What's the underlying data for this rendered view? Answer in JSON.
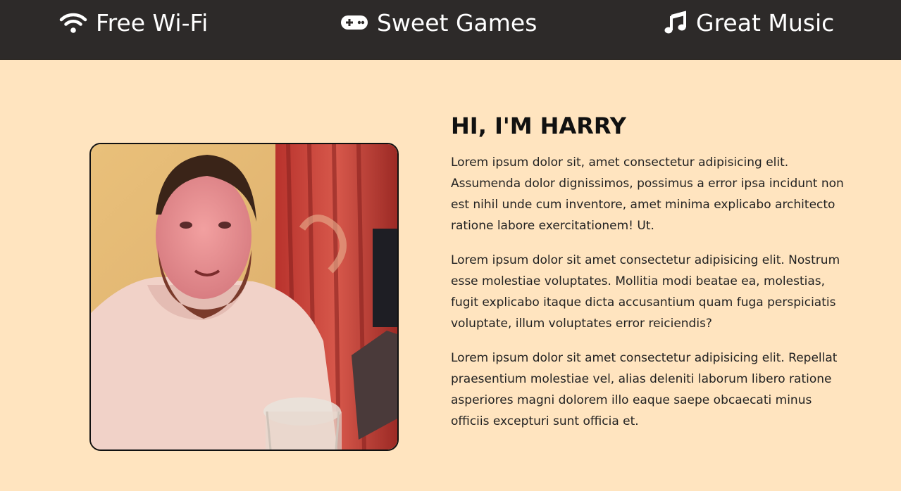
{
  "header": {
    "features": [
      {
        "icon": "wifi-icon",
        "label": "Free Wi-Fi"
      },
      {
        "icon": "gamepad-icon",
        "label": "Sweet Games"
      },
      {
        "icon": "music-note-icon",
        "label": "Great Music"
      }
    ]
  },
  "about": {
    "heading": "HI, I'M HARRY",
    "paragraphs": [
      "Lorem ipsum dolor sit, amet consectetur adipisicing elit. Assumenda dolor dignissimos, possimus a error ipsa incidunt non est nihil unde cum inventore, amet minima explicabo architecto ratione labore exercitationem! Ut.",
      "Lorem ipsum dolor sit amet consectetur adipisicing elit. Nostrum esse molestiae voluptates. Mollitia modi beatae ea, molestias, fugit explicabo itaque dicta accusantium quam fuga perspiciatis voluptate, illum voluptates error reiciendis?",
      "Lorem ipsum dolor sit amet consectetur adipisicing elit. Repellat praesentium molestiae vel, alias deleniti laborum libero ratione asperiores magni dolorem illo eaque saepe obcaecati minus officiis excepturi sunt officia et."
    ]
  },
  "colors": {
    "topbar": "#2d2a29",
    "page_background": "#ffe4bf",
    "text": "#222222"
  }
}
